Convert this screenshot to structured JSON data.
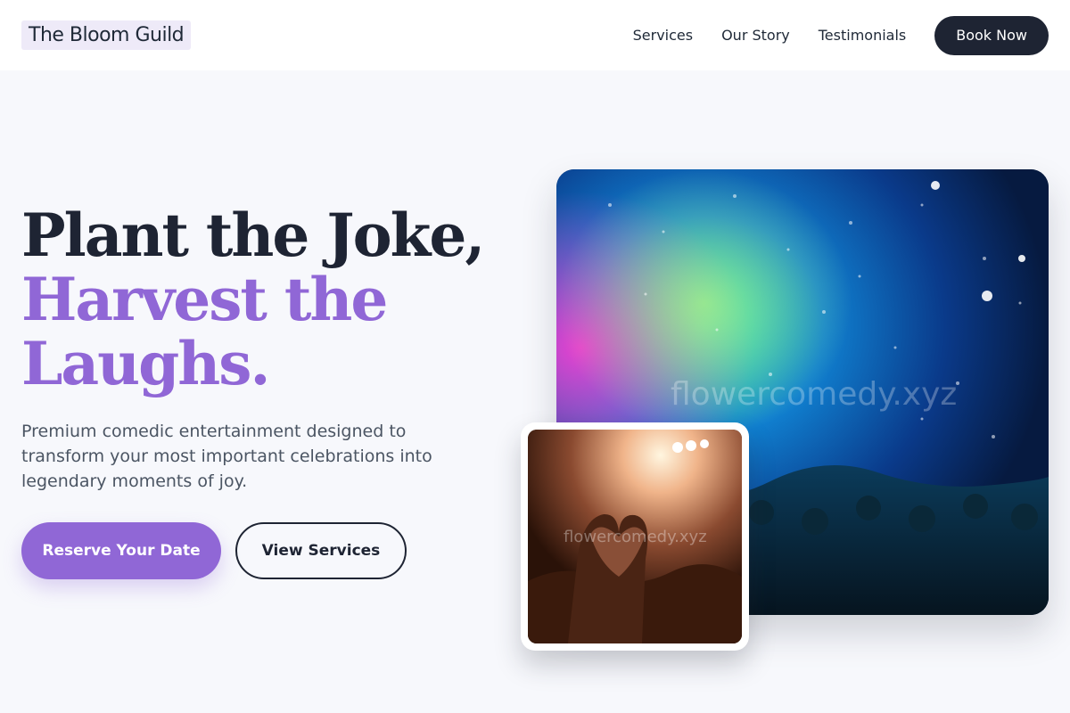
{
  "brand": {
    "name": "The Bloom Guild"
  },
  "nav": {
    "links": [
      "Services",
      "Our Story",
      "Testimonials"
    ],
    "cta_label": "Book Now"
  },
  "hero": {
    "headline_line1": "Plant the Joke,",
    "headline_line2a": "Harvest the",
    "headline_line2b": "Laughs.",
    "subtext": "Premium comedic entertainment designed to transform your most important celebrations into legendary moments of joy.",
    "primary_cta": "Reserve Your Date",
    "secondary_cta": "View Services"
  },
  "images": {
    "main_watermark": "flowercomedy.xyz",
    "small_watermark": "flowercomedy.xyz"
  },
  "colors": {
    "accent": "#9067d6",
    "dark": "#1e2433",
    "background": "#f7f8fc"
  }
}
